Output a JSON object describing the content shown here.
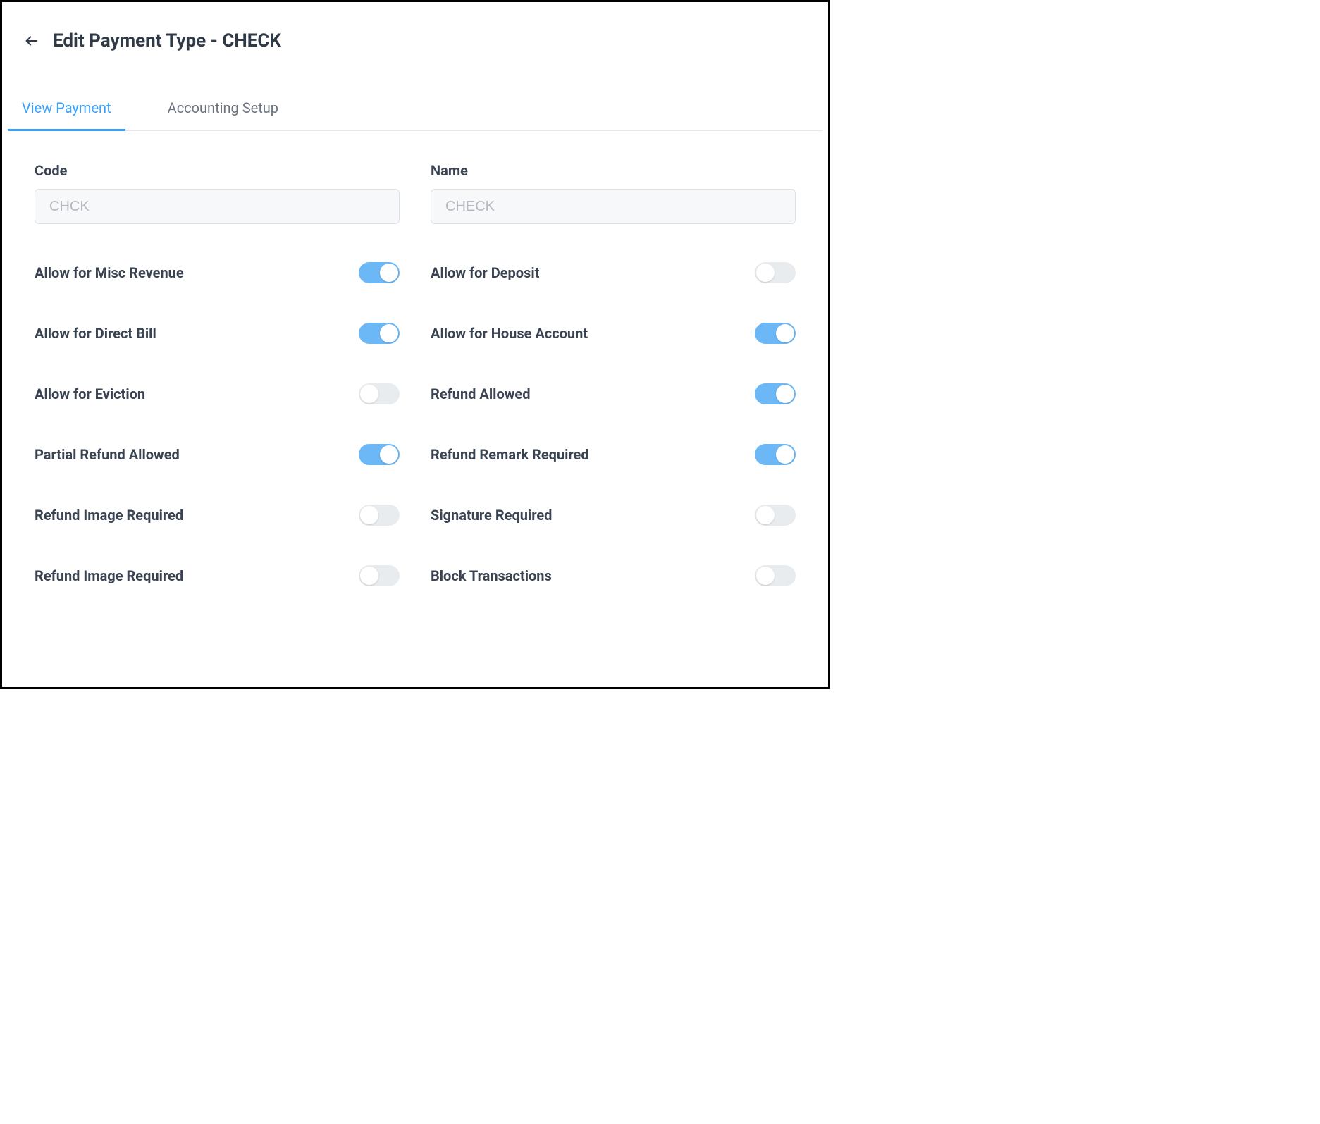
{
  "header": {
    "title": "Edit Payment Type - CHECK"
  },
  "tabs": [
    {
      "label": "View Payment",
      "active": true
    },
    {
      "label": "Accounting Setup",
      "active": false
    }
  ],
  "fields": {
    "code": {
      "label": "Code",
      "value": "CHCK"
    },
    "name": {
      "label": "Name",
      "value": "CHECK"
    }
  },
  "toggles": [
    {
      "key": "allow-misc-revenue",
      "label": "Allow for Misc Revenue",
      "on": true
    },
    {
      "key": "allow-deposit",
      "label": "Allow for Deposit",
      "on": false
    },
    {
      "key": "allow-direct-bill",
      "label": "Allow for Direct Bill",
      "on": true
    },
    {
      "key": "allow-house-account",
      "label": "Allow for House Account",
      "on": true
    },
    {
      "key": "allow-eviction",
      "label": "Allow for Eviction",
      "on": false
    },
    {
      "key": "refund-allowed",
      "label": "Refund Allowed",
      "on": true
    },
    {
      "key": "partial-refund-allowed",
      "label": "Partial Refund Allowed",
      "on": true
    },
    {
      "key": "refund-remark-required",
      "label": "Refund Remark Required",
      "on": true
    },
    {
      "key": "refund-image-required-1",
      "label": "Refund Image Required",
      "on": false
    },
    {
      "key": "signature-required",
      "label": "Signature Required",
      "on": false
    },
    {
      "key": "refund-image-required-2",
      "label": "Refund Image Required",
      "on": false
    },
    {
      "key": "block-transactions",
      "label": "Block Transactions",
      "on": false
    }
  ],
  "colors": {
    "accent": "#3aa0ff",
    "toggleOn": "#6cb8f7",
    "toggleOff": "#e9ecef",
    "textDark": "#303a47",
    "textMuted": "#6b7380"
  }
}
